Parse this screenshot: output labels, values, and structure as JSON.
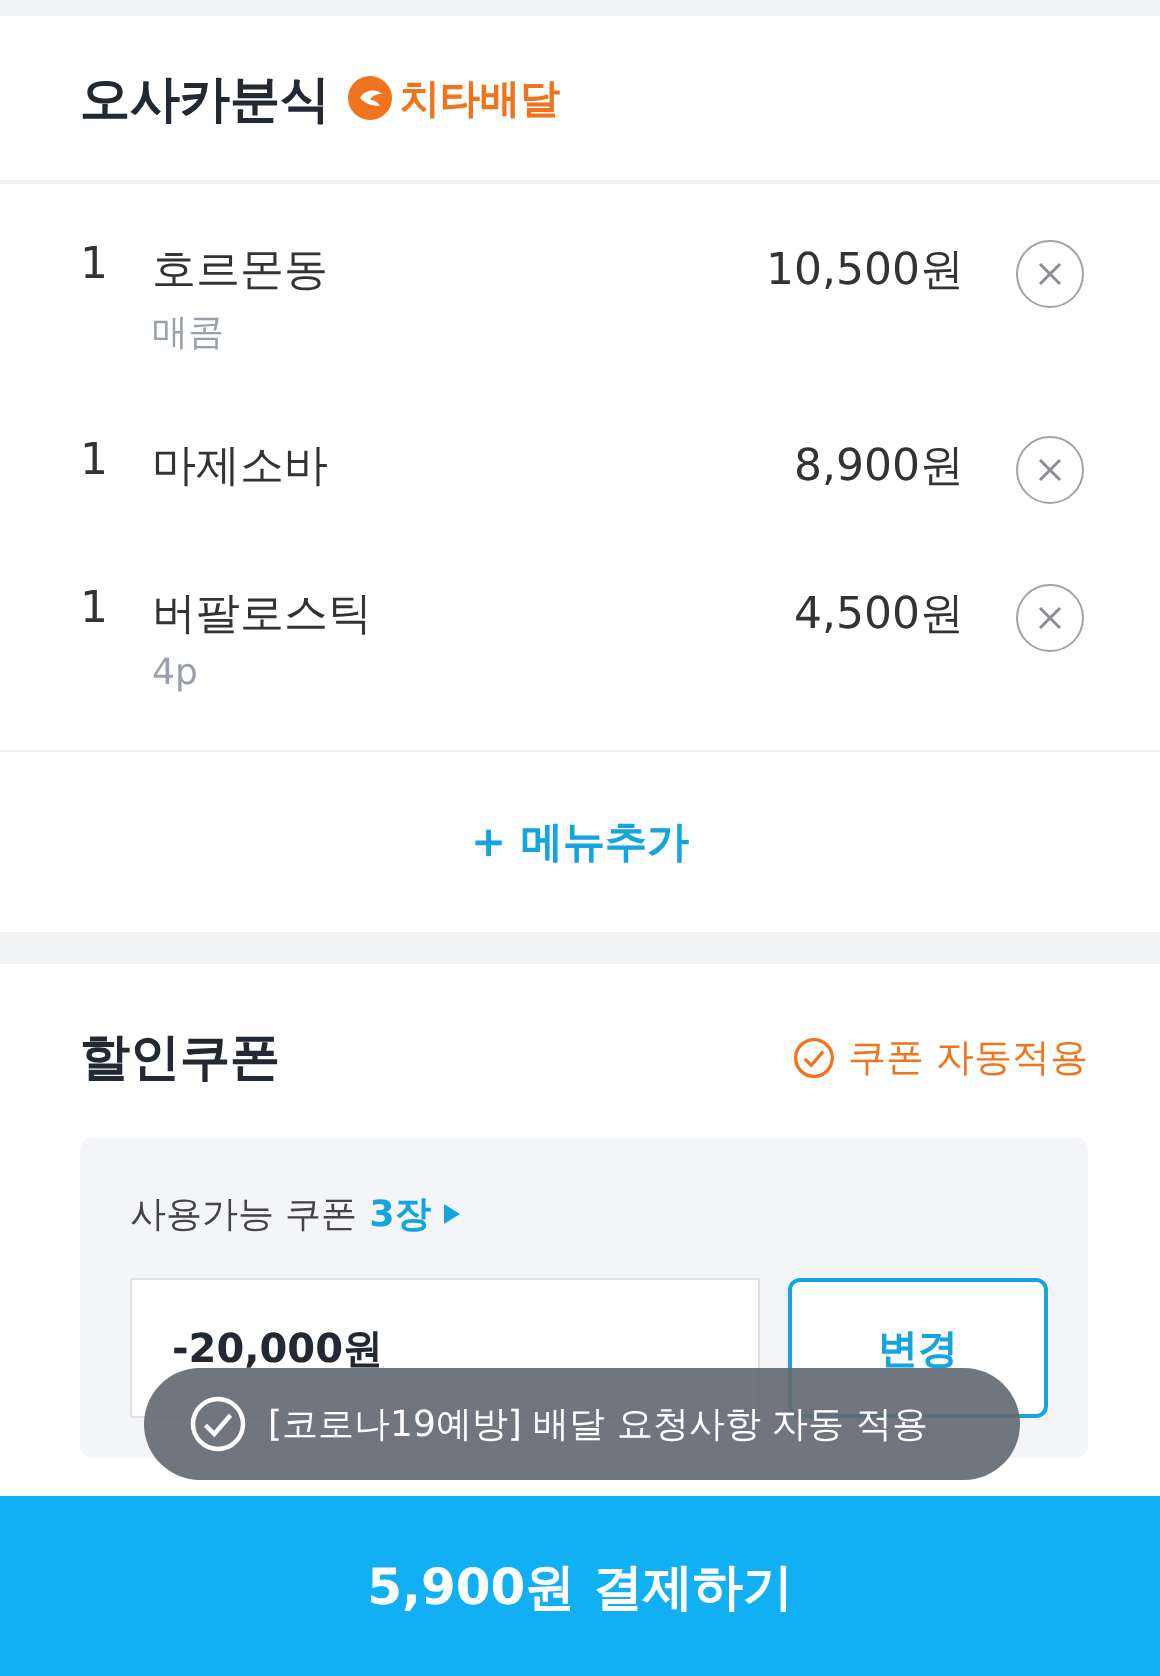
{
  "store": {
    "name": "오사카분식",
    "badge": "치타배달"
  },
  "items": [
    {
      "qty": "1",
      "name": "호르몬동",
      "option": "매콤",
      "price": "10,500원"
    },
    {
      "qty": "1",
      "name": "마제소바",
      "price": "8,900원"
    },
    {
      "qty": "1",
      "name": "버팔로스틱",
      "option": "4p",
      "price": "4,500원"
    }
  ],
  "add_menu": "+ 메뉴추가",
  "coupon": {
    "title": "할인쿠폰",
    "auto_apply": {
      "label": "쿠폰 자동적용",
      "checked": true
    },
    "available_label": "사용가능 쿠폰",
    "available_count": "3장",
    "amount": "-20,000원",
    "change_button": "변경"
  },
  "toast": "[코로나19예방] 배달 요청사항 자동 적용",
  "pay_button": "5,900원 결제하기"
}
